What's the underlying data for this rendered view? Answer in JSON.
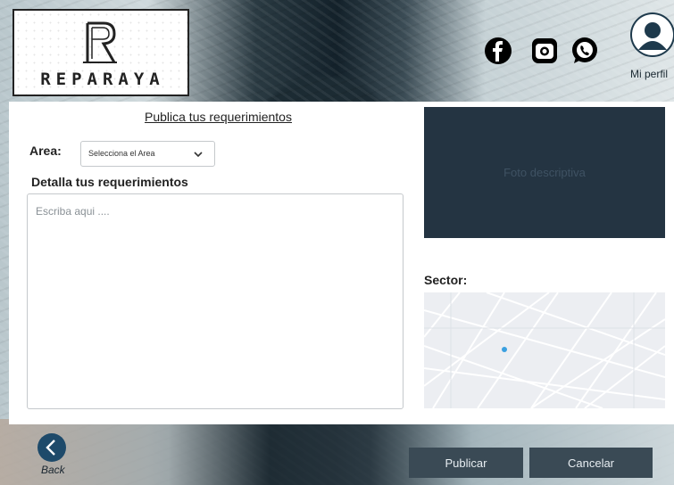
{
  "brand": {
    "logo_text": "REPARAYA"
  },
  "header": {
    "social": [
      {
        "icon": "facebook-icon",
        "color": "#000000"
      },
      {
        "icon": "instagram-icon",
        "color": "#000000"
      },
      {
        "icon": "whatsapp-icon",
        "color": "#000000"
      }
    ],
    "profile_label": "Mi perfil"
  },
  "form": {
    "title": "Publica tus requerimientos",
    "area_label": "Area:",
    "area_select_value": "Selecciona el Area",
    "details_label": "Detalla tus requerimientos",
    "details_placeholder": "Escriba aqui ....",
    "photo_label": "Foto descriptiva",
    "sector_label": "Sector:"
  },
  "footer": {
    "back_label": "Back",
    "publish_label": "Publicar",
    "cancel_label": "Cancelar"
  },
  "colors": {
    "panel": "#ffffff",
    "photo_box": "#243442",
    "button": "#3a4a55",
    "map_pin": "#3aa0e0"
  }
}
